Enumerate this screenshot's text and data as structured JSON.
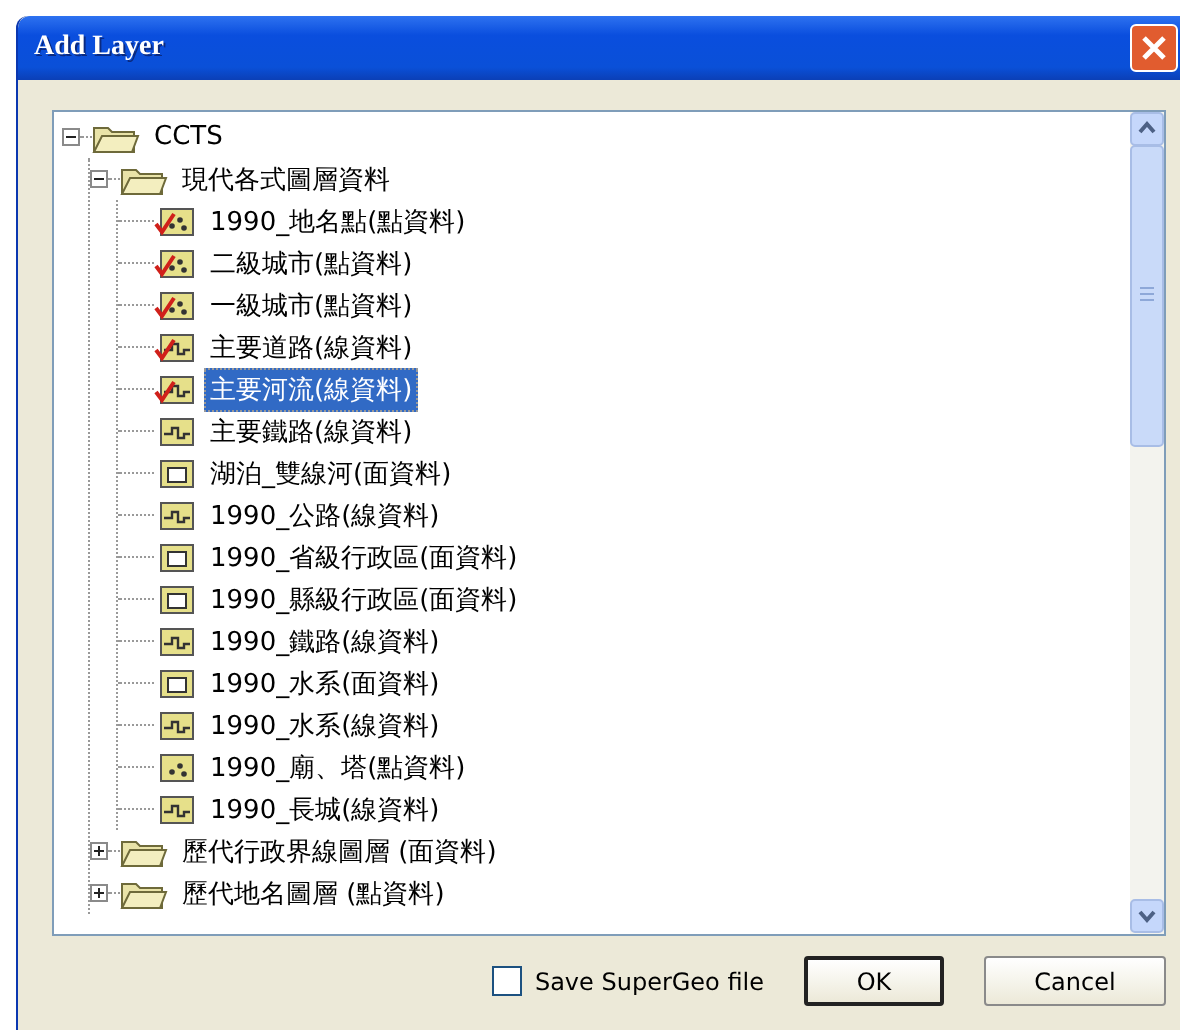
{
  "window": {
    "title": "Add Layer"
  },
  "tree": [
    {
      "kind": "folder",
      "label": "CCTS",
      "expanded": true,
      "children": [
        {
          "kind": "folder",
          "label": "現代各式圖層資料",
          "expanded": true,
          "children": [
            {
              "kind": "point",
              "label": "1990_地名點(點資料)",
              "checked": true,
              "selected": false
            },
            {
              "kind": "point",
              "label": "二級城市(點資料)",
              "checked": true,
              "selected": false
            },
            {
              "kind": "point",
              "label": "一級城市(點資料)",
              "checked": true,
              "selected": false
            },
            {
              "kind": "line",
              "label": "主要道路(線資料)",
              "checked": true,
              "selected": false
            },
            {
              "kind": "line",
              "label": "主要河流(線資料)",
              "checked": true,
              "selected": true
            },
            {
              "kind": "line",
              "label": "主要鐵路(線資料)",
              "checked": false,
              "selected": false
            },
            {
              "kind": "polygon",
              "label": "湖泊_雙線河(面資料)",
              "checked": false,
              "selected": false
            },
            {
              "kind": "line",
              "label": "1990_公路(線資料)",
              "checked": false,
              "selected": false
            },
            {
              "kind": "polygon",
              "label": "1990_省級行政區(面資料)",
              "checked": false,
              "selected": false
            },
            {
              "kind": "polygon",
              "label": "1990_縣級行政區(面資料)",
              "checked": false,
              "selected": false
            },
            {
              "kind": "line",
              "label": "1990_鐵路(線資料)",
              "checked": false,
              "selected": false
            },
            {
              "kind": "polygon",
              "label": "1990_水系(面資料)",
              "checked": false,
              "selected": false
            },
            {
              "kind": "line",
              "label": "1990_水系(線資料)",
              "checked": false,
              "selected": false
            },
            {
              "kind": "point",
              "label": "1990_廟、塔(點資料)",
              "checked": false,
              "selected": false
            },
            {
              "kind": "line",
              "label": "1990_長城(線資料)",
              "checked": false,
              "selected": false
            }
          ]
        },
        {
          "kind": "folder",
          "label": "歷代行政界線圖層 (面資料)",
          "expanded": false
        },
        {
          "kind": "folder",
          "label": "歷代地名圖層 (點資料)",
          "expanded": false
        }
      ]
    }
  ],
  "save_option": {
    "label": "Save SuperGeo file",
    "checked": false
  },
  "buttons": [
    {
      "label": "OK",
      "default": true
    },
    {
      "label": "Cancel",
      "default": false
    }
  ]
}
